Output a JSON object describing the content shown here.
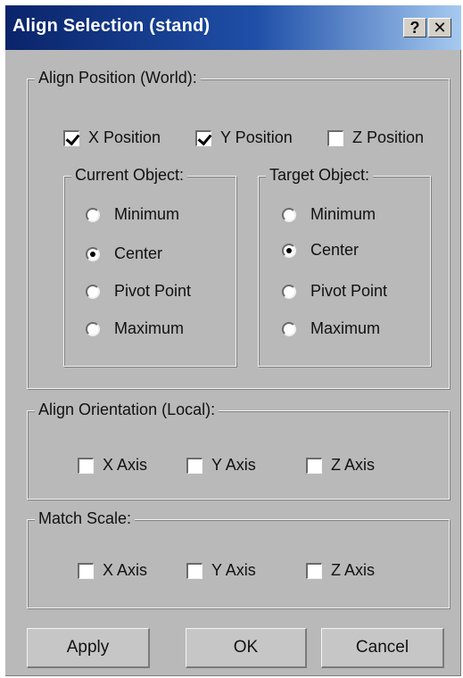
{
  "window": {
    "title": "Align Selection (stand)",
    "help_label": "?",
    "close_label": "✕"
  },
  "align_position": {
    "label": "Align Position (World):",
    "checkboxes": [
      {
        "label": "X Position",
        "checked": true
      },
      {
        "label": "Y Position",
        "checked": true
      },
      {
        "label": "Z Position",
        "checked": false
      }
    ],
    "current_object": {
      "label": "Current Object:",
      "options": [
        "Minimum",
        "Center",
        "Pivot Point",
        "Maximum"
      ],
      "selected": "Center"
    },
    "target_object": {
      "label": "Target Object:",
      "options": [
        "Minimum",
        "Center",
        "Pivot Point",
        "Maximum"
      ],
      "selected": "Center"
    }
  },
  "align_orientation": {
    "label": "Align Orientation (Local):",
    "checkboxes": [
      {
        "label": "X Axis",
        "checked": false
      },
      {
        "label": "Y Axis",
        "checked": false
      },
      {
        "label": "Z Axis",
        "checked": false
      }
    ]
  },
  "match_scale": {
    "label": "Match Scale:",
    "checkboxes": [
      {
        "label": "X Axis",
        "checked": false
      },
      {
        "label": "Y Axis",
        "checked": false
      },
      {
        "label": "Z Axis",
        "checked": false
      }
    ]
  },
  "buttons": {
    "apply": "Apply",
    "ok": "OK",
    "cancel": "Cancel"
  },
  "colors": {
    "title_bar": "#0a246a",
    "dialog_bg": "#b9b9b9"
  }
}
